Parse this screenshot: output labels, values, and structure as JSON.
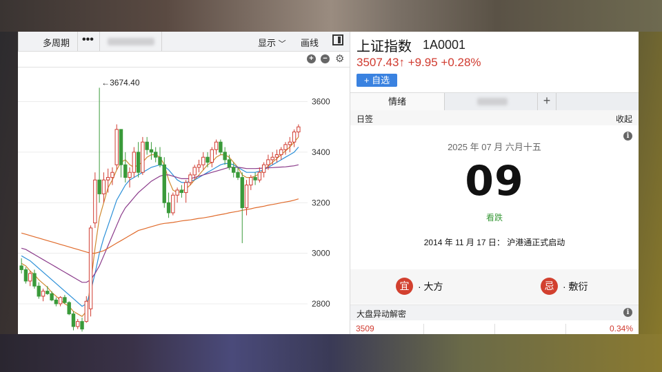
{
  "colors": {
    "up_red": "#d03a2f",
    "down_green": "#3a9a3a",
    "accent_blue": "#3a82e0",
    "badge_red": "#d2402f"
  },
  "toolbar": {
    "period_label": "多周期",
    "more_icon": "more-dots-icon",
    "display_label": "显示",
    "draw_label": "画线",
    "icons": [
      "zoom-in-icon",
      "zoom-out-icon",
      "gear-icon",
      "panel-toggle-icon",
      "chevron-down-icon"
    ]
  },
  "chart_data": {
    "type": "candlestick",
    "y_ticks": [
      "3600",
      "3400",
      "3200",
      "3000",
      "2800"
    ],
    "ylim": [
      2680,
      3735
    ],
    "annotation": {
      "text": "←3674.40",
      "value": 3674.4
    },
    "bars_ohlc": [
      [
        2950,
        2980,
        2920,
        2935
      ],
      [
        2935,
        2945,
        2880,
        2890
      ],
      [
        2890,
        2930,
        2870,
        2920
      ],
      [
        2920,
        2935,
        2860,
        2870
      ],
      [
        2870,
        2885,
        2820,
        2830
      ],
      [
        2830,
        2860,
        2810,
        2850
      ],
      [
        2850,
        2870,
        2835,
        2840
      ],
      [
        2840,
        2850,
        2810,
        2815
      ],
      [
        2815,
        2825,
        2790,
        2800
      ],
      [
        2800,
        2830,
        2790,
        2825
      ],
      [
        2825,
        2835,
        2800,
        2805
      ],
      [
        2805,
        2810,
        2755,
        2760
      ],
      [
        2760,
        2770,
        2695,
        2710
      ],
      [
        2710,
        2740,
        2700,
        2730
      ],
      [
        2730,
        2745,
        2690,
        2700
      ],
      [
        2730,
        2830,
        2725,
        2810
      ],
      [
        2780,
        3110,
        2750,
        3100
      ],
      [
        3120,
        3320,
        3100,
        3290
      ],
      [
        3290,
        3655,
        3200,
        3235
      ],
      [
        3235,
        3320,
        3200,
        3290
      ],
      [
        3290,
        3335,
        3240,
        3300
      ],
      [
        3300,
        3340,
        3270,
        3320
      ],
      [
        3350,
        3510,
        3330,
        3490
      ],
      [
        3490,
        3460,
        3300,
        3350
      ],
      [
        3350,
        3400,
        3280,
        3300
      ],
      [
        3300,
        3340,
        3260,
        3320
      ],
      [
        3320,
        3420,
        3300,
        3400
      ],
      [
        3400,
        3440,
        3300,
        3320
      ],
      [
        3320,
        3460,
        3310,
        3440
      ],
      [
        3440,
        3460,
        3390,
        3410
      ],
      [
        3410,
        3440,
        3370,
        3400
      ],
      [
        3400,
        3420,
        3360,
        3380
      ],
      [
        3380,
        3420,
        3340,
        3350
      ],
      [
        3350,
        3380,
        3180,
        3200
      ],
      [
        3200,
        3240,
        3140,
        3160
      ],
      [
        3160,
        3240,
        3150,
        3230
      ],
      [
        3230,
        3260,
        3200,
        3250
      ],
      [
        3250,
        3270,
        3220,
        3240
      ],
      [
        3240,
        3290,
        3200,
        3280
      ],
      [
        3280,
        3320,
        3270,
        3310
      ],
      [
        3310,
        3350,
        3290,
        3340
      ],
      [
        3340,
        3370,
        3320,
        3350
      ],
      [
        3350,
        3400,
        3330,
        3380
      ],
      [
        3380,
        3400,
        3340,
        3360
      ],
      [
        3360,
        3420,
        3340,
        3410
      ],
      [
        3410,
        3450,
        3390,
        3440
      ],
      [
        3440,
        3450,
        3390,
        3400
      ],
      [
        3400,
        3420,
        3350,
        3370
      ],
      [
        3370,
        3390,
        3330,
        3340
      ],
      [
        3340,
        3360,
        3300,
        3320
      ],
      [
        3320,
        3340,
        3290,
        3300
      ],
      [
        3300,
        3320,
        3040,
        3180
      ],
      [
        3180,
        3290,
        3150,
        3270
      ],
      [
        3270,
        3310,
        3250,
        3300
      ],
      [
        3300,
        3320,
        3270,
        3290
      ],
      [
        3290,
        3340,
        3280,
        3320
      ],
      [
        3320,
        3360,
        3300,
        3350
      ],
      [
        3350,
        3390,
        3330,
        3370
      ],
      [
        3370,
        3400,
        3350,
        3380
      ],
      [
        3380,
        3410,
        3360,
        3390
      ],
      [
        3390,
        3420,
        3370,
        3410
      ],
      [
        3410,
        3440,
        3390,
        3430
      ],
      [
        3430,
        3460,
        3400,
        3440
      ],
      [
        3440,
        3490,
        3420,
        3480
      ],
      [
        3480,
        3510,
        3460,
        3500
      ]
    ],
    "series": [
      {
        "color": "#d08a30",
        "values": [
          2960,
          2950,
          2930,
          2915,
          2895,
          2880,
          2865,
          2845,
          2830,
          2815,
          2800,
          2790,
          2770,
          2760,
          2750,
          2770,
          2880,
          3020,
          3140,
          3200,
          3260,
          3290,
          3330,
          3360,
          3370,
          3350,
          3340,
          3350,
          3360,
          3380,
          3390,
          3390,
          3380,
          3350,
          3290,
          3250,
          3240,
          3245,
          3255,
          3270,
          3290,
          3310,
          3330,
          3350,
          3360,
          3380,
          3390,
          3390,
          3380,
          3360,
          3340,
          3310,
          3300,
          3300,
          3305,
          3315,
          3330,
          3345,
          3360,
          3375,
          3390,
          3405,
          3420,
          3440,
          3460
        ]
      },
      {
        "color": "#2a8fd8",
        "values": [
          2990,
          2980,
          2970,
          2955,
          2940,
          2925,
          2910,
          2895,
          2880,
          2865,
          2850,
          2835,
          2820,
          2805,
          2790,
          2800,
          2850,
          2920,
          3000,
          3060,
          3110,
          3160,
          3210,
          3240,
          3270,
          3290,
          3300,
          3310,
          3320,
          3330,
          3340,
          3345,
          3350,
          3345,
          3330,
          3310,
          3290,
          3280,
          3280,
          3285,
          3290,
          3300,
          3310,
          3320,
          3330,
          3340,
          3350,
          3355,
          3355,
          3350,
          3340,
          3330,
          3320,
          3320,
          3320,
          3325,
          3330,
          3340,
          3350,
          3360,
          3370,
          3380,
          3390,
          3400,
          3420
        ]
      },
      {
        "color": "#8a3a8a",
        "values": [
          3020,
          3015,
          3005,
          2995,
          2985,
          2975,
          2965,
          2955,
          2945,
          2935,
          2925,
          2915,
          2905,
          2895,
          2885,
          2885,
          2895,
          2920,
          2950,
          2990,
          3030,
          3070,
          3110,
          3150,
          3180,
          3200,
          3220,
          3240,
          3255,
          3270,
          3285,
          3295,
          3305,
          3310,
          3310,
          3305,
          3300,
          3295,
          3295,
          3295,
          3300,
          3305,
          3310,
          3315,
          3320,
          3325,
          3330,
          3335,
          3340,
          3340,
          3340,
          3338,
          3335,
          3335,
          3335,
          3336,
          3337,
          3338,
          3339,
          3340,
          3341,
          3342,
          3344,
          3346,
          3350
        ]
      },
      {
        "color": "#e06a2a",
        "values": [
          3080,
          3075,
          3070,
          3065,
          3060,
          3055,
          3050,
          3045,
          3040,
          3035,
          3030,
          3025,
          3020,
          3015,
          3010,
          3005,
          3000,
          3000,
          3005,
          3010,
          3020,
          3030,
          3040,
          3050,
          3060,
          3070,
          3080,
          3090,
          3095,
          3100,
          3105,
          3110,
          3115,
          3118,
          3120,
          3122,
          3125,
          3128,
          3130,
          3132,
          3135,
          3138,
          3140,
          3143,
          3146,
          3150,
          3153,
          3156,
          3160,
          3163,
          3166,
          3170,
          3173,
          3176,
          3180,
          3183,
          3186,
          3190,
          3193,
          3196,
          3200,
          3203,
          3206,
          3210,
          3215
        ]
      }
    ]
  },
  "quote": {
    "name": "上证指数",
    "code": "1A0001",
    "price_line": "3507.43↑ +9.95 +0.28%",
    "add_label": "+ 自选"
  },
  "tabs": {
    "active": "情绪",
    "plus": "+"
  },
  "calendar": {
    "header_left": "日签",
    "header_right": "收起",
    "date_line": "2025 年 07 月 六月十五",
    "day": "09",
    "note": "看跌",
    "event": "2014 年 11 月 17 日： 沪港通正式启动",
    "yi_badge": "宜",
    "yi_text": "· 大方",
    "ji_badge": "忌",
    "ji_text": "· 敷衍"
  },
  "dapan": {
    "title": "大盘异动解密",
    "value_left": "3509",
    "value_right": "0.34%"
  }
}
